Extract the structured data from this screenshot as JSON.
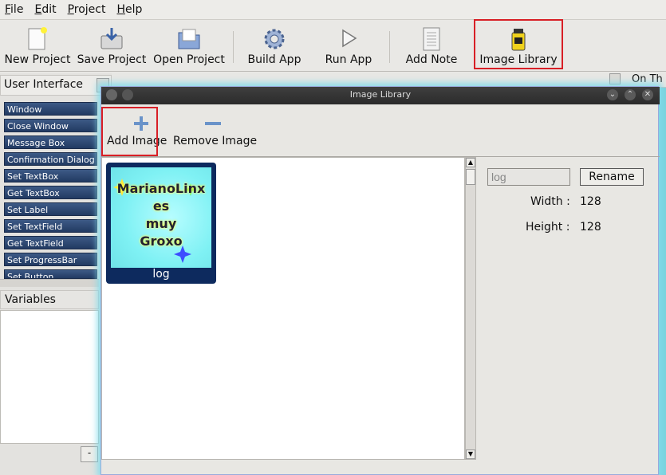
{
  "menu": [
    "File",
    "Edit",
    "Project",
    "Help"
  ],
  "toolbar": {
    "new_project": "New Project",
    "save_project": "Save Project",
    "open_project": "Open Project",
    "build_app": "Build App",
    "run_app": "Run App",
    "add_note": "Add Note",
    "image_library": "Image Library"
  },
  "left_panel": {
    "title": "User Interface",
    "commands": [
      "Window",
      "Close Window",
      "Message Box",
      "Confirmation Dialog",
      "Set TextBox",
      "Get TextBox",
      "Set Label",
      "Set TextField",
      "Get TextField",
      "Set ProgressBar",
      "Set Button"
    ],
    "variables_title": "Variables",
    "remove_variable": "-"
  },
  "background": {
    "top_right_label": "On Th"
  },
  "dialog": {
    "title": "Image Library",
    "add_image": "Add Image",
    "remove_image": "Remove Image",
    "images": [
      {
        "name": "log",
        "preview_text": [
          "MarianoLinx",
          "es",
          "muy",
          "Groxo"
        ]
      }
    ],
    "name_field_value": "log",
    "rename_label": "Rename",
    "width_label": "Width :",
    "width_value": "128",
    "height_label": "Height :",
    "height_value": "128"
  },
  "colors": {
    "highlight": "#d81f26",
    "command_bg": "#2b4470",
    "canvas": "#7ad2dd"
  }
}
